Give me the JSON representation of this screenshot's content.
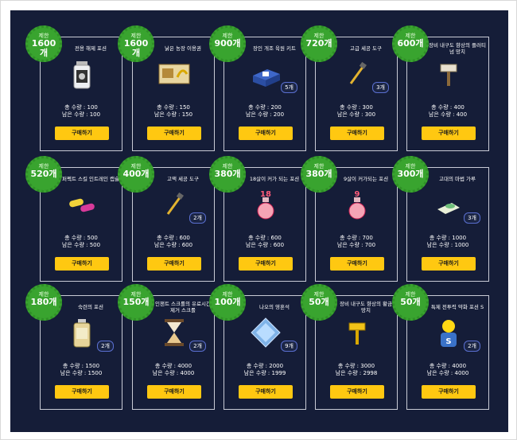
{
  "limit_label": "제한",
  "total_label": "총 수량 :",
  "remain_label": "남은 수량 :",
  "buy_label": "구매하기",
  "items": [
    {
      "limit": "1600개",
      "name": "전용 해제 포션",
      "total": "100",
      "remain": "100",
      "qty": "",
      "icon": "potion-bottle-icon"
    },
    {
      "limit": "1600개",
      "name": "낡은 농장 이용권",
      "total": "150",
      "remain": "150",
      "qty": "",
      "icon": "farm-ticket-icon"
    },
    {
      "limit": "900개",
      "name": "장인 개조 육원 키트",
      "total": "200",
      "remain": "200",
      "qty": "5개",
      "icon": "kit-box-icon"
    },
    {
      "limit": "720개",
      "name": "고급 세공 도구",
      "total": "300",
      "remain": "300",
      "qty": "3개",
      "icon": "crafting-tool-icon"
    },
    {
      "limit": "600개",
      "name": "장비 내구도 향상의 플러티넘 망치",
      "total": "400",
      "remain": "400",
      "qty": "",
      "icon": "platinum-hammer-icon"
    },
    {
      "limit": "520개",
      "name": "퍼펙트 스킬 인트레인 캡슐",
      "total": "500",
      "remain": "500",
      "qty": "",
      "icon": "capsule-icon"
    },
    {
      "limit": "400개",
      "name": "고액 세공 도구",
      "total": "600",
      "remain": "600",
      "qty": "2개",
      "icon": "crafting-tool-icon"
    },
    {
      "limit": "380개",
      "name": "18살이 커가 되는 포션",
      "total": "600",
      "remain": "600",
      "qty": "",
      "icon": "age-potion-18-icon"
    },
    {
      "limit": "380개",
      "name": "9살이 커가되는 포션",
      "total": "700",
      "remain": "700",
      "qty": "",
      "icon": "age-potion-9-icon"
    },
    {
      "limit": "300개",
      "name": "고대의 마법 가루",
      "total": "1000",
      "remain": "1000",
      "qty": "3개",
      "icon": "magic-powder-icon"
    },
    {
      "limit": "180개",
      "name": "숙련의 포션",
      "total": "1500",
      "remain": "1500",
      "qty": "2개",
      "icon": "mastery-potion-icon"
    },
    {
      "limit": "150개",
      "name": "인챈트 스크롤의 유료시간 제거 스크롤",
      "total": "4000",
      "remain": "4000",
      "qty": "2개",
      "icon": "hourglass-icon"
    },
    {
      "limit": "100개",
      "name": "나오의 영혼석",
      "total": "2000",
      "remain": "1999",
      "qty": "9개",
      "icon": "soul-stone-icon"
    },
    {
      "limit": "50개",
      "name": "장비 내구도 향상의 황금 망치",
      "total": "3000",
      "remain": "2998",
      "qty": "",
      "icon": "golden-hammer-icon"
    },
    {
      "limit": "50개",
      "name": "특제 전투력 약화 포션 S",
      "total": "4000",
      "remain": "4000",
      "qty": "2개",
      "icon": "chick-potion-icon"
    }
  ]
}
